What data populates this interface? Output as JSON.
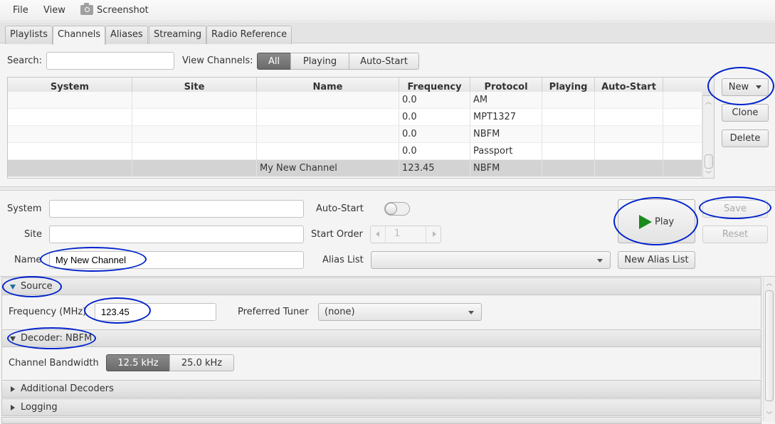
{
  "menu": {
    "file": "File",
    "view": "View",
    "screenshot": "Screenshot"
  },
  "tabs": [
    {
      "label": "Playlists",
      "active": false
    },
    {
      "label": "Channels",
      "active": true
    },
    {
      "label": "Aliases",
      "active": false
    },
    {
      "label": "Streaming",
      "active": false
    },
    {
      "label": "Radio Reference",
      "active": false
    }
  ],
  "search": {
    "label": "Search:",
    "value": "",
    "placeholder": ""
  },
  "view_channels": {
    "label": "View Channels:",
    "options": [
      "All",
      "Playing",
      "Auto-Start"
    ],
    "selected": "All"
  },
  "table": {
    "columns": [
      "System",
      "Site",
      "Name",
      "Frequency",
      "Protocol",
      "Playing",
      "Auto-Start"
    ],
    "rows": [
      {
        "system": "",
        "site": "",
        "name": "",
        "frequency": "0.0",
        "protocol": "AM",
        "playing": "",
        "auto_start": ""
      },
      {
        "system": "",
        "site": "",
        "name": "",
        "frequency": "0.0",
        "protocol": "MPT1327",
        "playing": "",
        "auto_start": ""
      },
      {
        "system": "",
        "site": "",
        "name": "",
        "frequency": "0.0",
        "protocol": "NBFM",
        "playing": "",
        "auto_start": ""
      },
      {
        "system": "",
        "site": "",
        "name": "",
        "frequency": "0.0",
        "protocol": "Passport",
        "playing": "",
        "auto_start": ""
      },
      {
        "system": "",
        "site": "",
        "name": "My New Channel",
        "frequency": "123.45",
        "protocol": "NBFM",
        "playing": "",
        "auto_start": "",
        "selected": true
      }
    ]
  },
  "table_buttons": {
    "new": "New",
    "clone": "Clone",
    "delete": "Delete"
  },
  "editor": {
    "system_label": "System",
    "system_value": "",
    "site_label": "Site",
    "site_value": "",
    "name_label": "Name",
    "name_value": "My New Channel",
    "auto_start_label": "Auto-Start",
    "auto_start_on": false,
    "start_order_label": "Start Order",
    "start_order_value": "1",
    "alias_list_label": "Alias List",
    "alias_list_value": "",
    "new_alias_list": "New Alias List",
    "play": "Play",
    "save": "Save",
    "reset": "Reset"
  },
  "sections": {
    "source": {
      "title": "Source",
      "expanded": true,
      "frequency_label": "Frequency (MHz)",
      "frequency_value": "123.45",
      "preferred_tuner_label": "Preferred Tuner",
      "preferred_tuner_value": "(none)"
    },
    "decoder": {
      "title": "Decoder: NBFM",
      "expanded": true,
      "bandwidth_label": "Channel Bandwidth",
      "bandwidth_options": [
        "12.5 kHz",
        "25.0 kHz"
      ],
      "bandwidth_selected": "12.5 kHz"
    },
    "additional_decoders": {
      "title": "Additional Decoders",
      "expanded": false
    },
    "logging": {
      "title": "Logging",
      "expanded": false
    }
  },
  "colors": {
    "play_icon": "#1a8a1a",
    "annotation": "#0022cc",
    "selected_segment": "#777777"
  }
}
